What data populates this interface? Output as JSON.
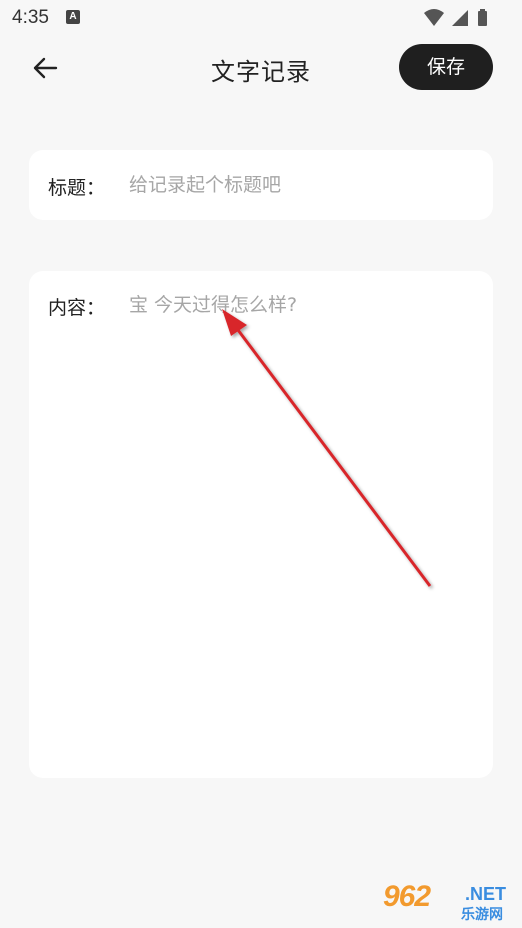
{
  "status_bar": {
    "time": "4:35",
    "notif_icon_glyph": "A",
    "icons": [
      "notification-a-icon",
      "wifi-icon",
      "cell-signal-icon",
      "battery-icon"
    ]
  },
  "app_bar": {
    "back_icon": "arrow-left-icon",
    "title": "文字记录",
    "save_label": "保存"
  },
  "title_field": {
    "label": "标题：",
    "value": "",
    "placeholder": "给记录起个标题吧"
  },
  "content_field": {
    "label": "内容：",
    "value": "",
    "placeholder": "宝 今天过得怎么样?"
  },
  "annotation": {
    "type": "red-arrow",
    "color": "#d8252b"
  },
  "watermark": {
    "logo": "962",
    "suffix": ".NET",
    "sub": "乐游网"
  },
  "colors": {
    "background": "#f7f7f7",
    "card": "#ffffff",
    "save_button": "#1f1f1f",
    "placeholder": "#a6a6a6"
  }
}
